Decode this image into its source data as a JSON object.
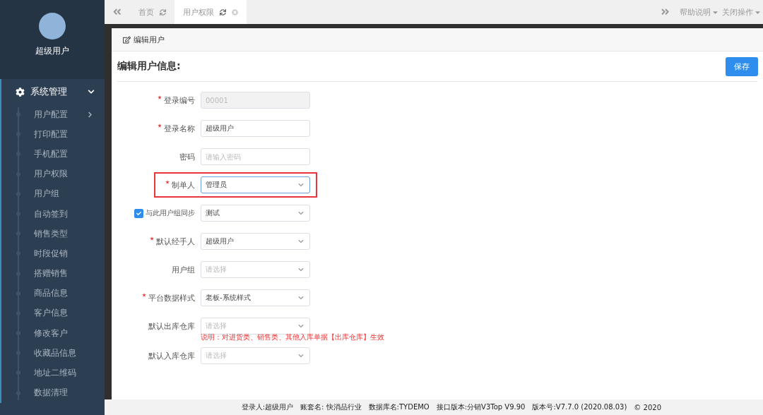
{
  "sidebar": {
    "user_name": "超级用户",
    "menu": {
      "label": "系统管理",
      "expanded": true,
      "items": [
        {
          "label": "用户配置",
          "has_children": true
        },
        {
          "label": "打印配置",
          "has_children": false
        },
        {
          "label": "手机配置",
          "has_children": false
        },
        {
          "label": "用户权限",
          "has_children": false
        },
        {
          "label": "用户组",
          "has_children": false
        },
        {
          "label": "自动签到",
          "has_children": false
        },
        {
          "label": "销售类型",
          "has_children": false
        },
        {
          "label": "时段促销",
          "has_children": false
        },
        {
          "label": "搭赠销售",
          "has_children": false
        },
        {
          "label": "商品信息",
          "has_children": false
        },
        {
          "label": "客户信息",
          "has_children": false
        },
        {
          "label": "修改客户",
          "has_children": false
        },
        {
          "label": "收藏品信息",
          "has_children": false
        },
        {
          "label": "地址二维码",
          "has_children": false
        },
        {
          "label": "数据清理",
          "has_children": false
        }
      ]
    }
  },
  "tabs": [
    {
      "label": "首页",
      "selected": false,
      "closable": false
    },
    {
      "label": "用户权限",
      "selected": true,
      "closable": true
    }
  ],
  "top_menus": [
    "帮助说明",
    "关闭操作"
  ],
  "panel": {
    "header": "编辑用户",
    "title": "编辑用户信息:",
    "save_button": "保存",
    "fields": [
      {
        "label": "登录编号",
        "kind": "input",
        "required": true,
        "disabled": true,
        "value": "00001",
        "highlighted": false
      },
      {
        "label": "登录名称",
        "kind": "input",
        "required": true,
        "disabled": false,
        "value": "超级用户",
        "highlighted": false
      },
      {
        "label": "密码",
        "kind": "input",
        "required": false,
        "disabled": false,
        "placeholder": "请输入密码",
        "highlighted": false
      },
      {
        "label": "制单人",
        "kind": "select",
        "required": true,
        "disabled": false,
        "value": "管理员",
        "highlighted": true
      },
      {
        "label": "与此用户组同步",
        "kind": "select",
        "checked": true,
        "required": false,
        "disabled": false,
        "value": "测试",
        "highlighted": false
      },
      {
        "label": "默认经手人",
        "kind": "select",
        "required": true,
        "disabled": false,
        "value": "超级用户",
        "highlighted": false
      },
      {
        "label": "用户组",
        "kind": "select",
        "required": false,
        "disabled": false,
        "placeholder": "请选择",
        "highlighted": false
      },
      {
        "label": "平台数据样式",
        "kind": "select",
        "required": true,
        "disabled": false,
        "value": "老板-系统样式",
        "highlighted": false
      },
      {
        "label": "默认出库仓库",
        "kind": "select",
        "required": false,
        "disabled": false,
        "placeholder": "请选择",
        "highlighted": false,
        "note": "说明：对进货类、销售类、其他入库单据【出库仓库】生效"
      },
      {
        "label": "默认入库仓库",
        "kind": "select",
        "required": false,
        "disabled": false,
        "placeholder": "请选择",
        "highlighted": false
      }
    ]
  },
  "status_bar": [
    "登录人:超级用户",
    "账套名: 快消品行业",
    "数据库名:TYDEMO",
    "接口版本:分销V3Top V9.90",
    "版本号:V7.7.0 (2020.08.03)",
    "© 2020"
  ]
}
